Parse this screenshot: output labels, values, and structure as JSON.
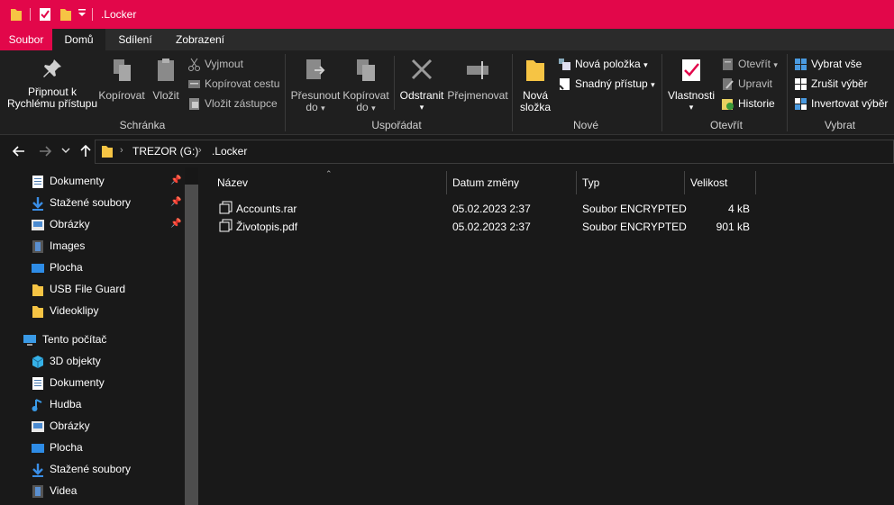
{
  "window": {
    "title": ".Locker"
  },
  "tabs": [
    {
      "label": "Soubor"
    },
    {
      "label": "Domů"
    },
    {
      "label": "Sdílení"
    },
    {
      "label": "Zobrazení"
    }
  ],
  "ribbon": {
    "clipboard": {
      "pin_line1": "Připnout k",
      "pin_line2": "Rychlému přístupu",
      "copy": "Kopírovat",
      "paste": "Vložit",
      "cut": "Vyjmout",
      "copy_path": "Kopírovat cestu",
      "paste_shortcut": "Vložit zástupce",
      "group": "Schránka"
    },
    "organize": {
      "move_line1": "Přesunout",
      "move_line2": "do",
      "copyto_line1": "Kopírovat",
      "copyto_line2": "do",
      "delete": "Odstranit",
      "rename": "Přejmenovat",
      "group": "Uspořádat"
    },
    "new": {
      "folder_line1": "Nová",
      "folder_line2": "složka",
      "new_item": "Nová položka",
      "easy_access": "Snadný přístup",
      "group": "Nové"
    },
    "open": {
      "properties": "Vlastnosti",
      "open": "Otevřít",
      "edit": "Upravit",
      "history": "Historie",
      "group": "Otevřít"
    },
    "select": {
      "select_all": "Vybrat vše",
      "select_none": "Zrušit výběr",
      "invert": "Invertovat výběr",
      "group": "Vybrat"
    }
  },
  "address": {
    "crumbs": [
      "TREZOR (G:)",
      ".Locker"
    ]
  },
  "nav": {
    "quick_access": [
      {
        "label": "Dokumenty",
        "icon": "documents-icon",
        "pinned": true
      },
      {
        "label": "Stažené soubory",
        "icon": "downloads-icon",
        "pinned": true
      },
      {
        "label": "Obrázky",
        "icon": "pictures-icon",
        "pinned": true
      },
      {
        "label": "Images",
        "icon": "film-icon",
        "pinned": false
      },
      {
        "label": "Plocha",
        "icon": "desktop-icon",
        "pinned": false
      },
      {
        "label": "USB File Guard",
        "icon": "folder-icon",
        "pinned": false
      },
      {
        "label": "Videoklipy",
        "icon": "folder-icon",
        "pinned": false
      }
    ],
    "this_pc": {
      "label": "Tento počítač",
      "icon": "computer-icon"
    },
    "this_pc_items": [
      {
        "label": "3D objekty",
        "icon": "3d-objects-icon"
      },
      {
        "label": "Dokumenty",
        "icon": "documents-icon"
      },
      {
        "label": "Hudba",
        "icon": "music-icon"
      },
      {
        "label": "Obrázky",
        "icon": "pictures-icon"
      },
      {
        "label": "Plocha",
        "icon": "desktop-icon"
      },
      {
        "label": "Stažené soubory",
        "icon": "downloads-icon"
      },
      {
        "label": "Videa",
        "icon": "film-icon"
      }
    ]
  },
  "columns": [
    "Název",
    "Datum změny",
    "Typ",
    "Velikost"
  ],
  "files": [
    {
      "name": "Accounts.rar",
      "modified": "05.02.2023 2:37",
      "type": "Soubor ENCRYPTED",
      "size": "4 kB"
    },
    {
      "name": "Životopis.pdf",
      "modified": "05.02.2023 2:37",
      "type": "Soubor ENCRYPTED",
      "size": "901 kB"
    }
  ],
  "colors": {
    "accent": "#e2074a",
    "background": "#191919",
    "ribbon": "#1f1f1f"
  }
}
